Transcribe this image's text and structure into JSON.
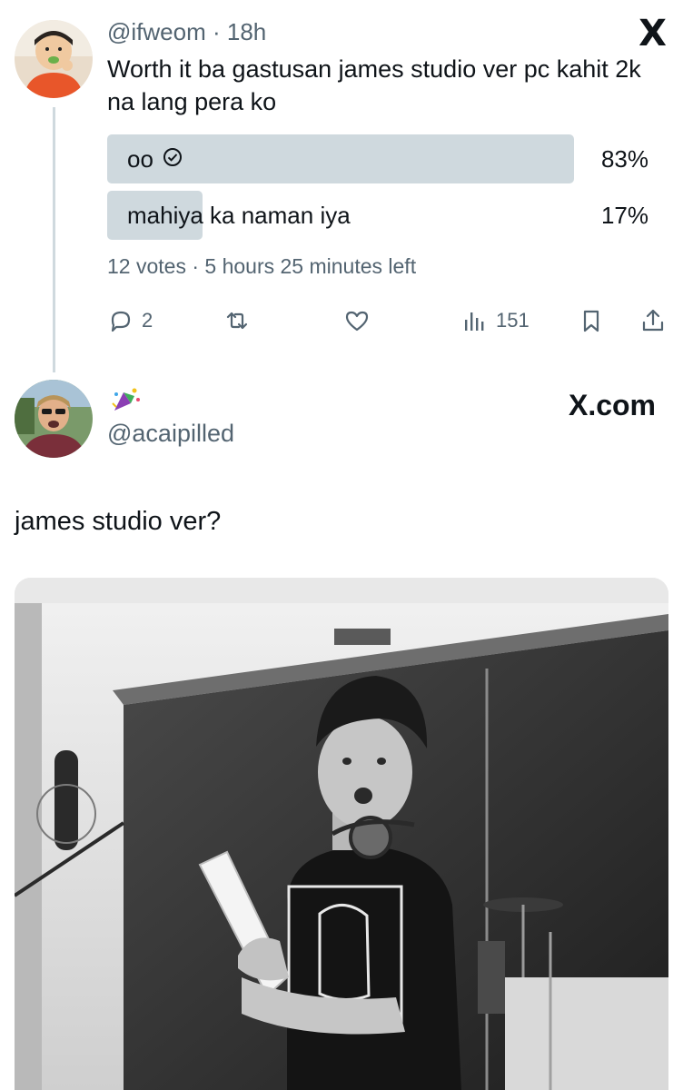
{
  "tweet": {
    "handle": "@ifweom",
    "separator": "·",
    "time": "18h",
    "text": "Worth it ba gastusan james studio ver pc kahit 2k na lang pera ko",
    "avatar": "toddler-eating-avatar"
  },
  "poll": {
    "options": [
      {
        "label": "oo",
        "percent": "83%",
        "fraction": 0.83,
        "winner": true,
        "icon": "check-circle-icon"
      },
      {
        "label": "mahiya ka naman iya",
        "percent": "17%",
        "fraction": 0.17,
        "winner": false
      }
    ],
    "votes": "12 votes",
    "separator": "·",
    "time_left": "5 hours 25 minutes left"
  },
  "actions": {
    "reply_count": "2",
    "retweet_count": "",
    "like_count": "",
    "views_count": "151",
    "icons": [
      "reply-icon",
      "retweet-icon",
      "like-icon",
      "views-icon",
      "bookmark-icon",
      "share-icon"
    ]
  },
  "brand": {
    "x_logo": "X",
    "x_com": "X.com"
  },
  "reply": {
    "handle": "@acaipilled",
    "text": "james studio ver?",
    "avatar": "person-with-sunglasses-avatar",
    "emoji": "party-sparkle-emoji"
  },
  "colors": {
    "text_primary": "#0f1419",
    "text_secondary": "#536471",
    "poll_fill": "#cfd9de",
    "thread_line": "#cfd9de"
  }
}
